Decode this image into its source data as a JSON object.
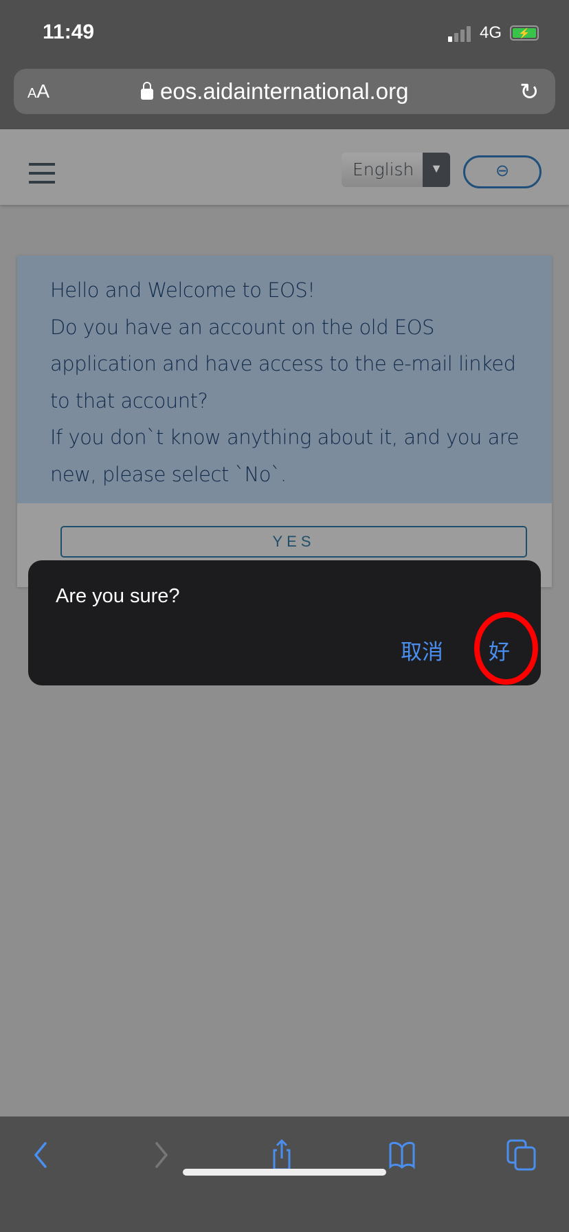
{
  "status_bar": {
    "time": "11:49",
    "network": "4G",
    "signal_bars": 1,
    "battery_charging": true
  },
  "browser": {
    "text_size_label": "AA",
    "url": "eos.aidainternational.org",
    "reload_icon": "reload-icon"
  },
  "site_header": {
    "language": "English",
    "menu_icon": "hamburger-icon",
    "login_icon": "login-icon"
  },
  "card": {
    "lines": [
      "Hello and Welcome to EOS!",
      "Do you have an account on the old EOS application and have access to the e-mail linked to that account?",
      "If you don`t know anything about it, and you are new, please select `No`."
    ],
    "yes_label": "YES"
  },
  "dialog": {
    "message": "Are you sure?",
    "cancel_label": "取消",
    "ok_label": "好"
  },
  "annotation": {
    "color": "#ff0000"
  },
  "toolbar": {
    "accent": "#4a8ff0"
  }
}
